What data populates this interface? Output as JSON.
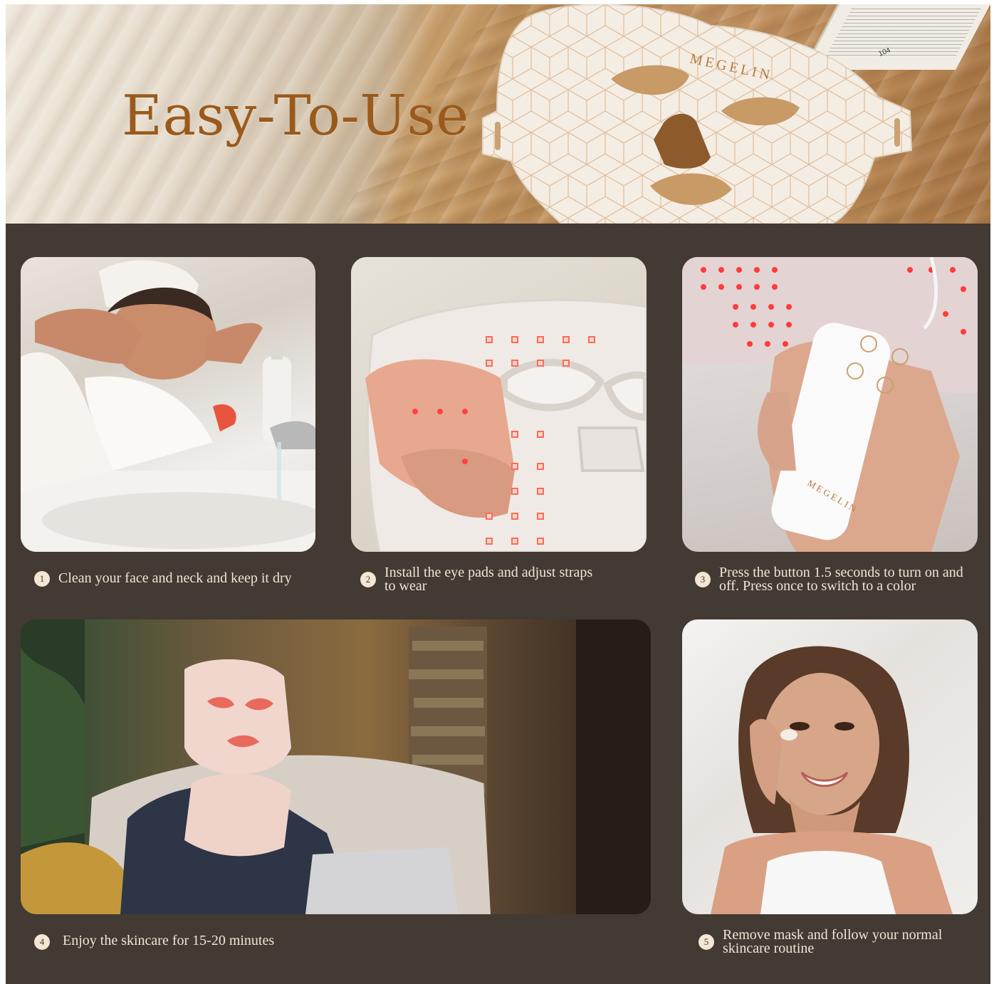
{
  "hero": {
    "title": "Easy-To-Use",
    "brand": "MEGELIN",
    "book_page": "104"
  },
  "steps": [
    {
      "number": "1",
      "text": "Clean your face and neck and keep it dry"
    },
    {
      "number": "2",
      "text": "Install the eye pads and adjust straps to wear"
    },
    {
      "number": "3",
      "text": "Press the button 1.5 seconds to turn on and off. Press once to switch to a color"
    },
    {
      "number": "4",
      "text": "Enjoy the skincare for 15-20 minutes"
    },
    {
      "number": "5",
      "text": "Remove mask and follow your normal skincare routine"
    }
  ],
  "colors": {
    "background": "#423a33",
    "title": "#9a5a1c",
    "caption": "#f1e6d6",
    "badge": "#f3e6d3",
    "led_red": "#ff3b3b"
  }
}
